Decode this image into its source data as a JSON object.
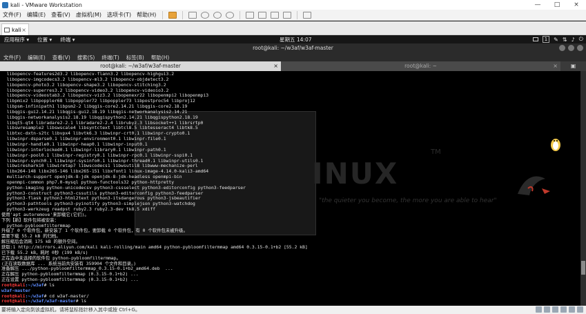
{
  "vmware": {
    "title": "kali - VMware Workstation",
    "menu": [
      "文件(F)",
      "编辑(E)",
      "查看(V)",
      "虚拟机(M)",
      "选项卡(T)",
      "帮助(H)"
    ],
    "tab_label": "kali",
    "tab_close": "×",
    "window_buttons": [
      "—",
      "□",
      "×"
    ],
    "status_text": "要将输入定向到该虚拟机，请将鼠标指针移入其中或按 Ctrl+G。"
  },
  "kali_panel": {
    "applications": "应用程序 ▾",
    "places": "位置 ▾",
    "terminal_menu": "终端 ▾",
    "clock": "星期五 14:07",
    "workspace": "1"
  },
  "terminal": {
    "window_title": "root@kali: ~/w3af/w3af-master",
    "menu": [
      "文件(F)",
      "编辑(E)",
      "查看(V)",
      "搜索(S)",
      "终端(T)",
      "标签(B)",
      "帮助(H)"
    ],
    "tabs": [
      {
        "label": "root@kali: ~/w3af/w3af-master",
        "active": true
      },
      {
        "label": "root@kali: ~",
        "active": false
      }
    ],
    "tab_close": "×",
    "lines": [
      {
        "text": "  libopencv-features2d3.2 libopencv-flann3.2 libopencv-highgui3.2"
      },
      {
        "text": "  libopencv-imgcodecs3.2 libopencv-ml3.2 libopencv-objdetect3.2"
      },
      {
        "text": "  libopencv-photo3.2 libopencv-shape3.2 libopencv-stitching3.2"
      },
      {
        "text": "  libopencv-superres3.2 libopencv-video3.2 libopencv-videoio3.2"
      },
      {
        "text": "  libopencv-videostab3.2 libopencv-viz3.2 libopenexr22 libopenmpi2 libopenmpi3"
      },
      {
        "text": "  libpmix2 libpoppler68 libpoppler72 libpoppler73 libpostproc54 libproj12"
      },
      {
        "text": "  libpsm-infinipath1 libpsm2-2 libqgis-core2.14.21 libqgis-core2.18.19"
      },
      {
        "text": "  libqgis-gui2.14.21 libqgis-gui2.18.19 libqgis-networkanalysis2.14.21"
      },
      {
        "text": "  libqgis-networkanalysis2.18.19 libqgispython2.14.21 libqgispython2.18.19"
      },
      {
        "text": "  libqt5-qt4 libradare2-2.1 libradare2-2.4 librubyz.3 libsocket++1 librsrtp0"
      },
      {
        "text": "  libswresample2 libswscale4 libsyntctext libtcl8.5 libtesseract4 libtk8.5"
      },
      {
        "text": "  libtxc-dxtn-s2tc libvpx4 libvtk6.3 libwinpr-crt0.1 libwinpr-crypto0.1"
      },
      {
        "text": "  libwinpr-dsparse0.1 libwinpr-environment0.1 libwinpr-file0.1"
      },
      {
        "text": "  libwinpr-handle0.1 libwinpr-heap0.1 libwinpr-input0.1"
      },
      {
        "text": "  libwinpr-interlocked0.1 libwinpr-library0.1 libwinpr-path0.1"
      },
      {
        "text": "  libwinpr-pool0.1 libwinpr-registry0.1 libwinpr-rpc0.1 libwinpr-sspi0.1"
      },
      {
        "text": "  libwinpr-synch0.1 libwinpr-sysinfo0.1 libwinpr-thread0.1 libwinpr-utils0.1"
      },
      {
        "text": "  libwireshark10 libwiretap7 libwscodecs1 libwsutil8 libwww-mechanize-perl"
      },
      {
        "text": "  libx264-148 libx265-146 libx265-151 libxfont1 linux-image-4.14.0-kali3-amd64"
      },
      {
        "text": "  multiarch-support openjdk-8-jdk openjdk-8-jdk-headless openmpi-bin"
      },
      {
        "text": "  openmpi-common php7.0-mysql python-functools32 python-httpretty"
      },
      {
        "text": "  python-imaging python-unicodecsv python3-cssselect python3-editorconfig python3-feedparser"
      },
      {
        "text": "  python3-construct python3-cssutils python3-editorconfig python3-feedparser"
      },
      {
        "text": "  python3-flask python3-html2text python3-itsdangerous python3-jsbeautifier"
      },
      {
        "text": "  python3-pathtools python3-pyinotify python3-simplejson python3-watchdog"
      },
      {
        "text": "  python3-werkzeug readpst ruby2.3 ruby2.3-dev tk8.5 xdiff"
      },
      {
        "text": "使用'apt autoremove'来卸载它(它们)。"
      },
      {
        "text": "下列【新】软件包将被安装："
      },
      {
        "text": "  python-pybloomfiltermmap"
      },
      {
        "text": "升级了 0 个软件包，新安装了 1 个软件包，要卸载 0 个软件包，有 0 个软件包未被升级。"
      },
      {
        "text": "需要下载 55.2 kB 的归档。"
      },
      {
        "text": "解压缩后会消耗 175 kB 的额外空间。"
      },
      {
        "text": "获取:1 http://mirrors.aliyun.com/kali kali-rolling/main amd64 python-pybloomfiltermmap amd64 0.3.15-0.1+b2 [55.2 kB]"
      },
      {
        "text": "已下载 55.2 kB，耗时 0秒 (199 kB/s)"
      },
      {
        "text": "正在选中未选择的软件包 python-pybloomfiltermmap。"
      },
      {
        "text": "(正在读取数据库 ... 系统当前共安装有 359904 个文件和目录。)"
      },
      {
        "text": "准备解压 .../python-pybloomfiltermmap_0.3.15-0.1+b2_amd64.deb  ..."
      },
      {
        "text": "正在解压 python-pybloomfiltermmap (0.3.15-0.1+b2) ..."
      },
      {
        "text": "正在设置 python-pybloomfiltermmap (0.3.15-0.1+b2) ..."
      },
      {
        "prompt": "root@kali",
        "path": ":~/w3af",
        "cmd": "# ls"
      },
      {
        "text": "w3af-master",
        "style": "blue"
      },
      {
        "prompt": "root@kali",
        "path": ":~/w3af",
        "cmd": "# cd w3af-master/"
      },
      {
        "prompt": "root@kali",
        "path": ":~/w3af/w3af-master",
        "cmd": "# ls"
      }
    ]
  },
  "desktop": {
    "watermark_text": "INUX",
    "watermark_tm": "TM",
    "watermark_tagline": "\"the quieter you become, the more you are able to hear\""
  }
}
